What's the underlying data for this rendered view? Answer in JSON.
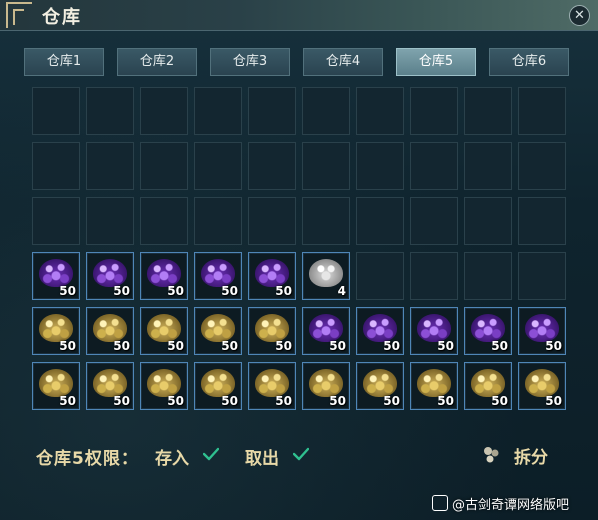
{
  "window": {
    "title": "仓库",
    "close_symbol": "✕"
  },
  "tabs": [
    {
      "label": "仓库1",
      "active": false
    },
    {
      "label": "仓库2",
      "active": false
    },
    {
      "label": "仓库3",
      "active": false
    },
    {
      "label": "仓库4",
      "active": false
    },
    {
      "label": "仓库5",
      "active": true
    },
    {
      "label": "仓库6",
      "active": false
    }
  ],
  "grid": {
    "columns": 10,
    "rows": 6,
    "slots": [
      null,
      null,
      null,
      null,
      null,
      null,
      null,
      null,
      null,
      null,
      null,
      null,
      null,
      null,
      null,
      null,
      null,
      null,
      null,
      null,
      null,
      null,
      null,
      null,
      null,
      null,
      null,
      null,
      null,
      null,
      {
        "item": "purple-gem-pile",
        "qty": "50"
      },
      {
        "item": "purple-gem-pile",
        "qty": "50"
      },
      {
        "item": "purple-gem-pile",
        "qty": "50"
      },
      {
        "item": "purple-gem-pile",
        "qty": "50"
      },
      {
        "item": "purple-gem-pile",
        "qty": "50"
      },
      {
        "item": "white-gem-pile",
        "qty": "4"
      },
      null,
      null,
      null,
      null,
      {
        "item": "gold-gem-pile",
        "qty": "50"
      },
      {
        "item": "gold-gem-pile",
        "qty": "50"
      },
      {
        "item": "gold-gem-pile",
        "qty": "50"
      },
      {
        "item": "gold-gem-pile",
        "qty": "50"
      },
      {
        "item": "gold-gem-pile",
        "qty": "50"
      },
      {
        "item": "purple-gem-pile",
        "qty": "50"
      },
      {
        "item": "purple-gem-pile",
        "qty": "50"
      },
      {
        "item": "purple-gem-pile",
        "qty": "50"
      },
      {
        "item": "purple-gem-pile",
        "qty": "50"
      },
      {
        "item": "purple-gem-pile",
        "qty": "50"
      },
      {
        "item": "gold-gem-pile",
        "qty": "50"
      },
      {
        "item": "gold-gem-pile",
        "qty": "50"
      },
      {
        "item": "gold-gem-pile",
        "qty": "50"
      },
      {
        "item": "gold-gem-pile",
        "qty": "50"
      },
      {
        "item": "gold-gem-pile",
        "qty": "50"
      },
      {
        "item": "gold-gem-pile",
        "qty": "50"
      },
      {
        "item": "gold-gem-pile",
        "qty": "50"
      },
      {
        "item": "gold-gem-pile",
        "qty": "50"
      },
      {
        "item": "gold-gem-pile",
        "qty": "50"
      },
      {
        "item": "gold-gem-pile",
        "qty": "50"
      }
    ]
  },
  "permissions": {
    "label": "仓库5权限：",
    "deposit_label": "存入",
    "withdraw_label": "取出",
    "check_color": "#2fbf8f"
  },
  "split": {
    "label": "拆分"
  },
  "watermark": {
    "text": "@古剑奇谭网络版吧"
  }
}
